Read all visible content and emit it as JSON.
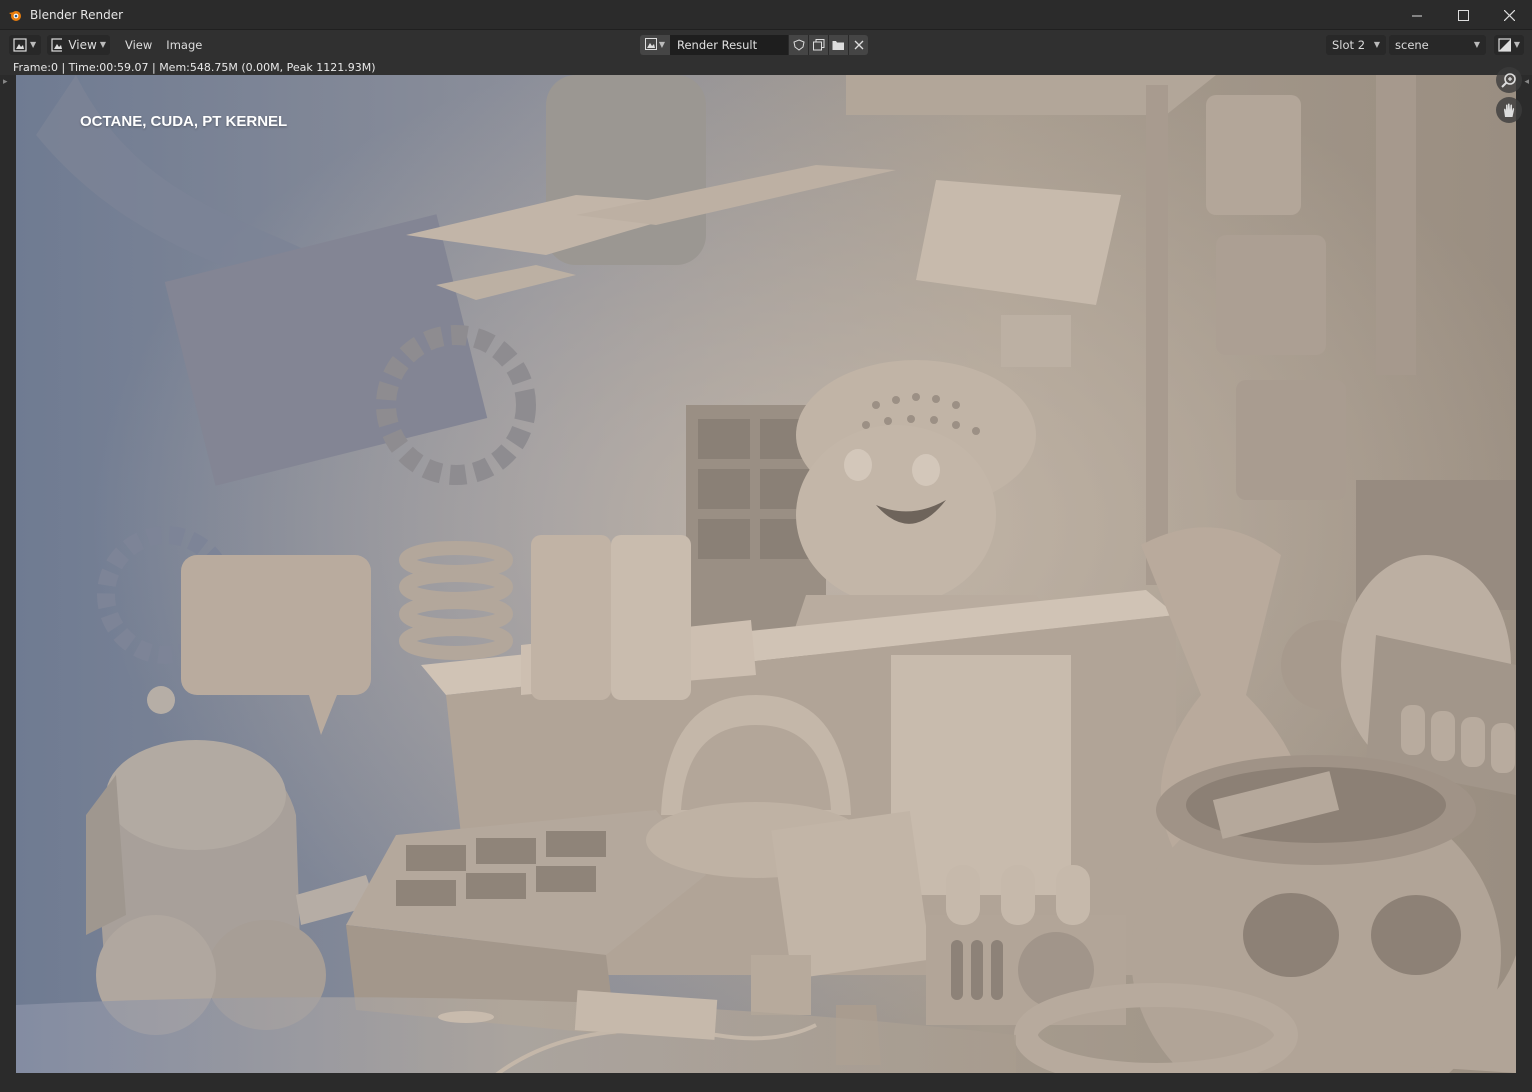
{
  "window": {
    "title": "Blender Render",
    "minimize_icon": "minimize-icon",
    "maximize_icon": "maximize-icon",
    "close_icon": "close-icon"
  },
  "header": {
    "editor_type_icon": "image-editor-icon",
    "mode_label": "View",
    "menus": [
      "View",
      "Image"
    ],
    "image_name": "Render Result",
    "slot": "Slot 2",
    "scene": "scene"
  },
  "status": {
    "text": "Frame:0 | Time:00:59.07 | Mem:548.75M (0.00M, Peak 1121.93M)"
  },
  "render": {
    "label": "OCTANE, CUDA, PT KERNEL"
  },
  "colors": {
    "titlebar": "#2b2b2b",
    "header": "#303030",
    "render_cool": "#8590a5",
    "render_warm": "#b4a798"
  }
}
